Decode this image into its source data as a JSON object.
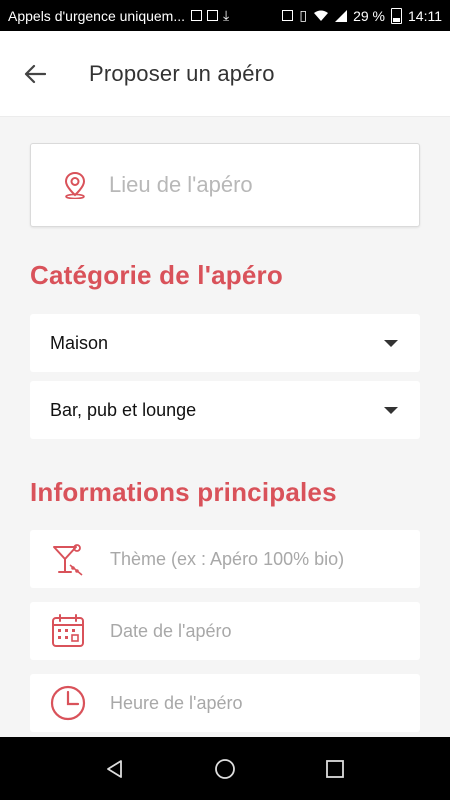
{
  "status_bar": {
    "carrier": "Appels d'urgence uniquem...",
    "battery": "29 %",
    "time": "14:11"
  },
  "header": {
    "title": "Proposer un apéro"
  },
  "lieu": {
    "placeholder": "Lieu de l'apéro"
  },
  "categorie": {
    "title": "Catégorie de l'apéro",
    "selects": [
      {
        "value": "Maison"
      },
      {
        "value": "Bar, pub et lounge"
      }
    ]
  },
  "informations": {
    "title": "Informations principales",
    "fields": [
      {
        "placeholder": "Thème (ex : Apéro 100% bio)",
        "icon": "cocktail-icon"
      },
      {
        "placeholder": "Date de l'apéro",
        "icon": "calendar-icon"
      },
      {
        "placeholder": "Heure de l'apéro",
        "icon": "clock-icon"
      }
    ]
  },
  "colors": {
    "accent": "#d9525a",
    "background": "#f5f5f5"
  }
}
